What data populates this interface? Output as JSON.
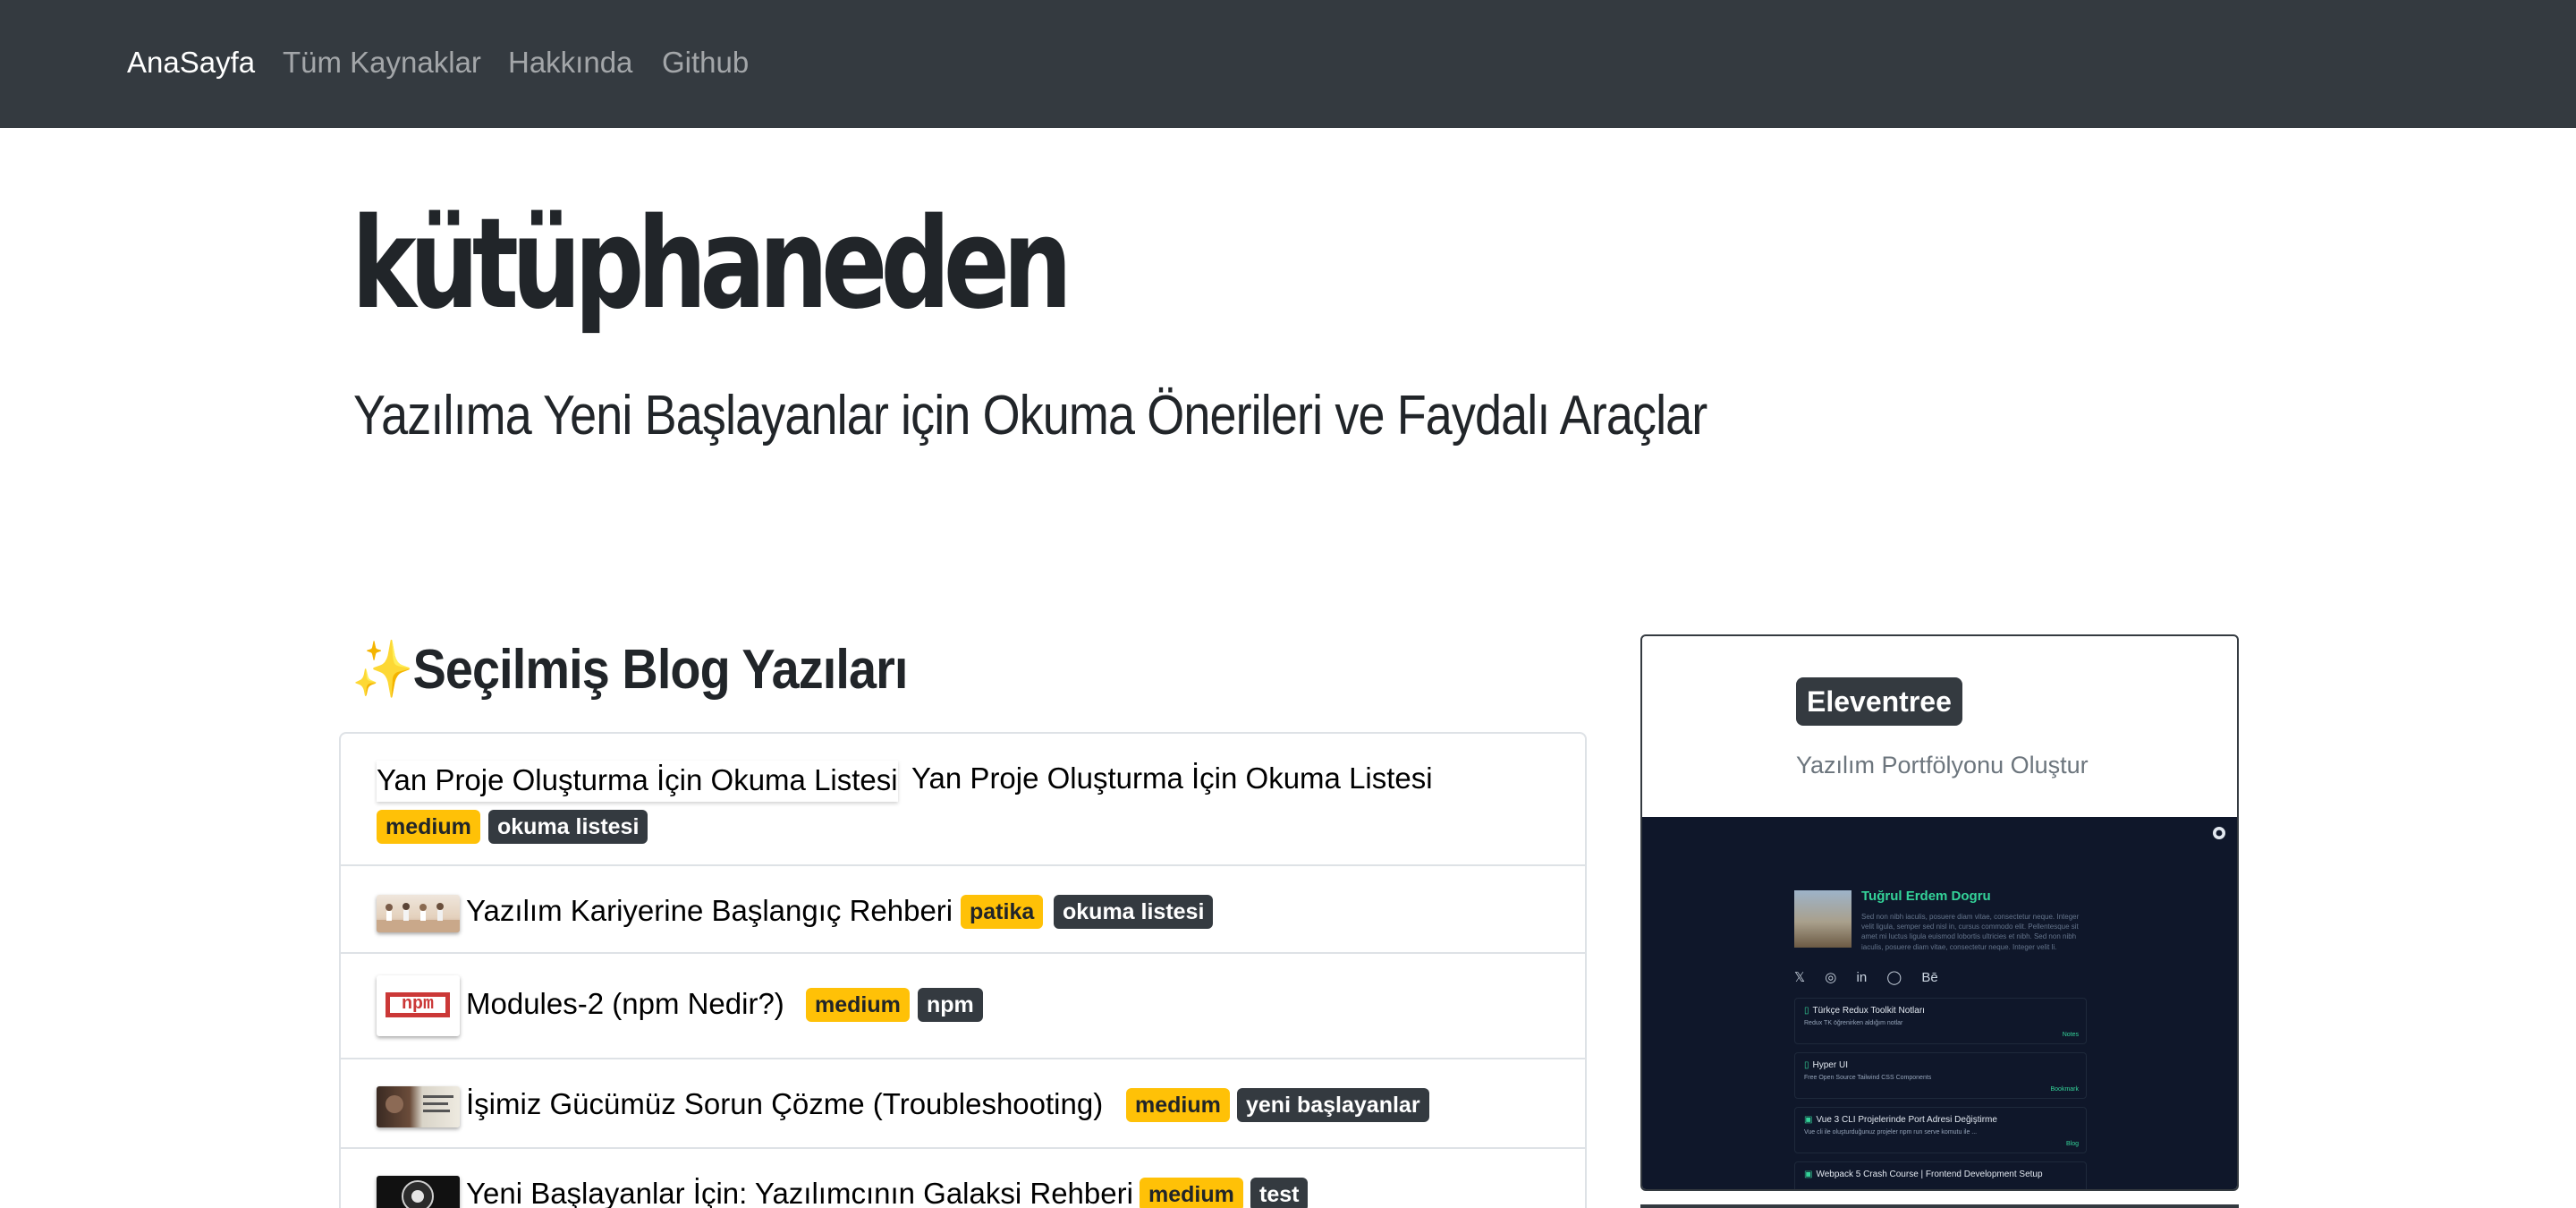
{
  "nav": {
    "items": [
      {
        "label": "AnaSayfa",
        "active": true
      },
      {
        "label": "Tüm Kaynaklar",
        "active": false
      },
      {
        "label": "Hakkında",
        "active": false
      },
      {
        "label": "Github",
        "active": false
      }
    ]
  },
  "hero": {
    "title": "kütüphaneden",
    "subtitle": "Yazılıma Yeni Başlayanlar için Okuma Önerileri ve Faydalı Araçlar"
  },
  "featured": {
    "heading_icon": "✨",
    "heading": "Seçilmiş Blog Yazıları",
    "posts": [
      {
        "image_alt": "Yan Proje Oluşturma İçin Okuma Listesi",
        "title": "Yan Proje Oluşturma İçin Okuma Listesi",
        "tags": [
          "medium",
          "okuma listesi"
        ]
      },
      {
        "title": "Yazılım Kariyerine Başlangıç Rehberi",
        "tags": [
          "patika",
          "okuma listesi"
        ]
      },
      {
        "thumb_text": "npm",
        "title": "Modules-2 (npm Nedir?)",
        "tags": [
          "medium",
          "npm"
        ]
      },
      {
        "title": "İşimiz Gücümüz Sorun Çözme (Troubleshooting)",
        "tags": [
          "medium",
          "yeni başlayanlar"
        ]
      },
      {
        "title": "Yeni Başlayanlar İçin: Yazılımcının Galaksi Rehberi",
        "tags": [
          "medium",
          "test"
        ]
      }
    ]
  },
  "sidebar_card": {
    "badge": "Eleventree",
    "subtitle": "Yazılım Portfölyonu Oluştur",
    "preview": {
      "name": "Tuğrul Erdem Dogru",
      "bio": "Sed non nibh iaculis, posuere diam vitae, consectetur neque. Integer velit ligula, semper sed nisl in, cursus commodo elit. Pellentesque sit amet mi luctus ligula euismod lobortis ultricies et nibh. Sed non nibh iaculis, posuere diam vitae, consectetur neque. Integer velit li.",
      "socials": [
        "𝕏",
        "◎",
        "in",
        "◯",
        "Bē"
      ],
      "links": [
        {
          "title": "Türkçe Redux Toolkit Notları",
          "sub": "Redux TK öğrenirken aldığım notlar",
          "tag": "Notes"
        },
        {
          "title": "Hyper UI",
          "sub": "Free Open Source Tailwind CSS Components",
          "tag": "Bookmark"
        },
        {
          "title": "Vue 3 CLI Projelerinde Port Adresi Değiştirme",
          "sub": "Vue cli ile oluşturduğunuz projeler npm run serve komutu ile ...",
          "tag": "Blog"
        },
        {
          "title": "Webpack 5 Crash Course | Frontend Development Setup",
          "sub": "",
          "tag": ""
        }
      ]
    }
  },
  "colors": {
    "navbar": "#343a40",
    "badge_yellow": "#ffc107",
    "badge_dark": "#343a40",
    "accent_green": "#34d399"
  }
}
